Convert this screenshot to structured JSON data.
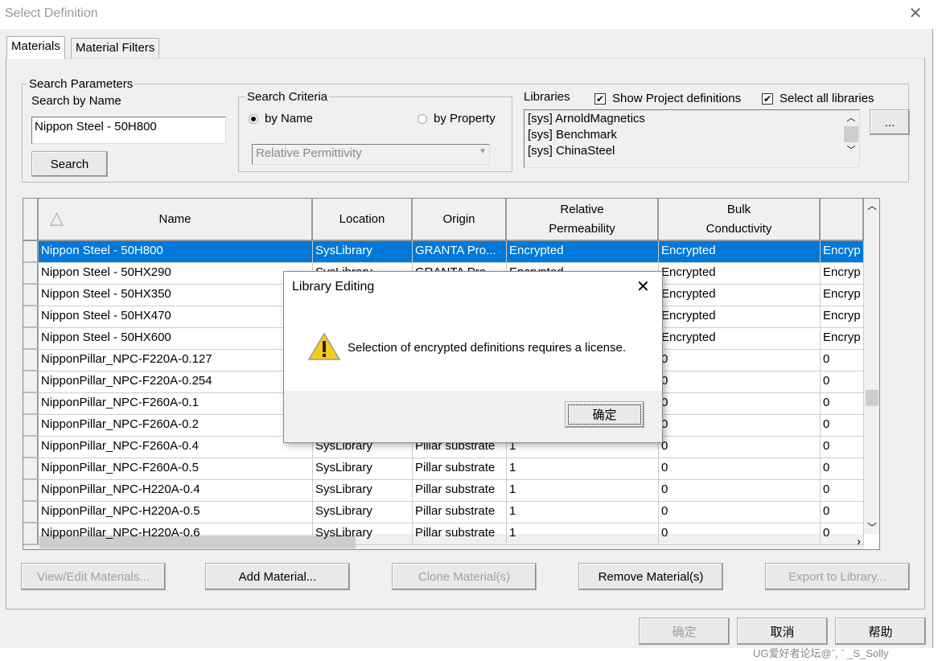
{
  "window": {
    "title": "Select Definition"
  },
  "tabs": [
    {
      "label": "Materials",
      "active": true
    },
    {
      "label": "Material Filters",
      "active": false
    }
  ],
  "search": {
    "group_label": "Search Parameters",
    "by_name_label": "Search by Name",
    "name_value": "Nippon Steel - 50H800",
    "search_button": "Search"
  },
  "criteria": {
    "group_label": "Search Criteria",
    "by_name": "by Name",
    "by_property": "by Property",
    "selected": "by Name",
    "property_value": "Relative Permittivity"
  },
  "libraries": {
    "label": "Libraries",
    "show_project": "Show Project definitions",
    "show_project_checked": true,
    "select_all": "Select all libraries",
    "select_all_checked": true,
    "items": [
      "[sys] ArnoldMagnetics",
      "[sys] Benchmark",
      "[sys] ChinaSteel"
    ],
    "more_button": "..."
  },
  "table": {
    "columns": [
      "Name",
      "Location",
      "Origin",
      "Relative\nPermeability",
      "Bulk\nConductivity",
      ""
    ],
    "rows": [
      [
        "Nippon Steel - 50H800",
        "SysLibrary",
        "GRANTA Pro...",
        "Encrypted",
        "Encrypted",
        "Encryp"
      ],
      [
        "Nippon Steel - 50HX290",
        "SysLibrary",
        "GRANTA Pro...",
        "Encrypted",
        "Encrypted",
        "Encryp"
      ],
      [
        "Nippon Steel - 50HX350",
        "",
        "",
        "",
        "Encrypted",
        "Encryp"
      ],
      [
        "Nippon Steel - 50HX470",
        "",
        "",
        "",
        "Encrypted",
        "Encryp"
      ],
      [
        "Nippon Steel - 50HX600",
        "",
        "",
        "",
        "Encrypted",
        "Encryp"
      ],
      [
        "NipponPillar_NPC-F220A-0.127",
        "",
        "",
        "",
        "0",
        "0"
      ],
      [
        "NipponPillar_NPC-F220A-0.254",
        "",
        "",
        "",
        "0",
        "0"
      ],
      [
        "NipponPillar_NPC-F260A-0.1",
        "",
        "",
        "",
        "0",
        "0"
      ],
      [
        "NipponPillar_NPC-F260A-0.2",
        "",
        "",
        "",
        "0",
        "0"
      ],
      [
        "NipponPillar_NPC-F260A-0.4",
        "SysLibrary",
        "Pillar substrate",
        "1",
        "0",
        "0"
      ],
      [
        "NipponPillar_NPC-F260A-0.5",
        "SysLibrary",
        "Pillar substrate",
        "1",
        "0",
        "0"
      ],
      [
        "NipponPillar_NPC-H220A-0.4",
        "SysLibrary",
        "Pillar substrate",
        "1",
        "0",
        "0"
      ],
      [
        "NipponPillar_NPC-H220A-0.5",
        "SysLibrary",
        "Pillar substrate",
        "1",
        "0",
        "0"
      ],
      [
        "NipponPillar_NPC-H220A-0.6",
        "SysLibrary",
        "Pillar substrate",
        "1",
        "0",
        "0"
      ]
    ],
    "selected_row": 0
  },
  "actions": [
    {
      "label": "View/Edit Materials...",
      "enabled": false
    },
    {
      "label": "Add Material...",
      "enabled": true
    },
    {
      "label": "Clone Material(s)",
      "enabled": false
    },
    {
      "label": "Remove Material(s)",
      "enabled": true
    },
    {
      "label": "Export to Library...",
      "enabled": false
    }
  ],
  "footer": {
    "ok": "确定",
    "cancel": "取消",
    "help": "帮助"
  },
  "dialog": {
    "title": "Library Editing",
    "message": "Selection of encrypted definitions requires a license.",
    "ok": "确定",
    "icon": "warning-icon"
  },
  "watermark": "UG爱好者论坛@ˇ, ˇ _S_Solly",
  "colors": {
    "selection": "#0078d7"
  }
}
